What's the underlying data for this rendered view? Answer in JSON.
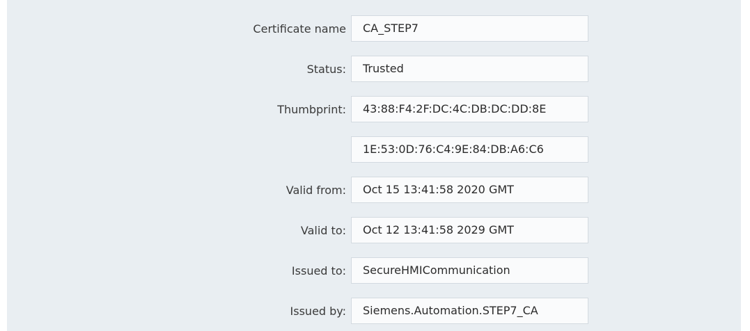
{
  "certificate": {
    "rows": [
      {
        "label": "Certificate name",
        "value": "CA_STEP7"
      },
      {
        "label": "Status:",
        "value": "Trusted"
      },
      {
        "label": "Thumbprint:",
        "value": "43:88:F4:2F:DC:4C:DB:DC:DD:8E"
      },
      {
        "label": "",
        "value": "1E:53:0D:76:C4:9E:84:DB:A6:C6"
      },
      {
        "label": "Valid from:",
        "value": "Oct 15 13:41:58 2020 GMT"
      },
      {
        "label": "Valid to:",
        "value": "Oct 12 13:41:58 2029 GMT"
      },
      {
        "label": "Issued to:",
        "value": "SecureHMICommunication"
      },
      {
        "label": "Issued by:",
        "value": "Siemens.Automation.STEP7_CA"
      }
    ]
  }
}
